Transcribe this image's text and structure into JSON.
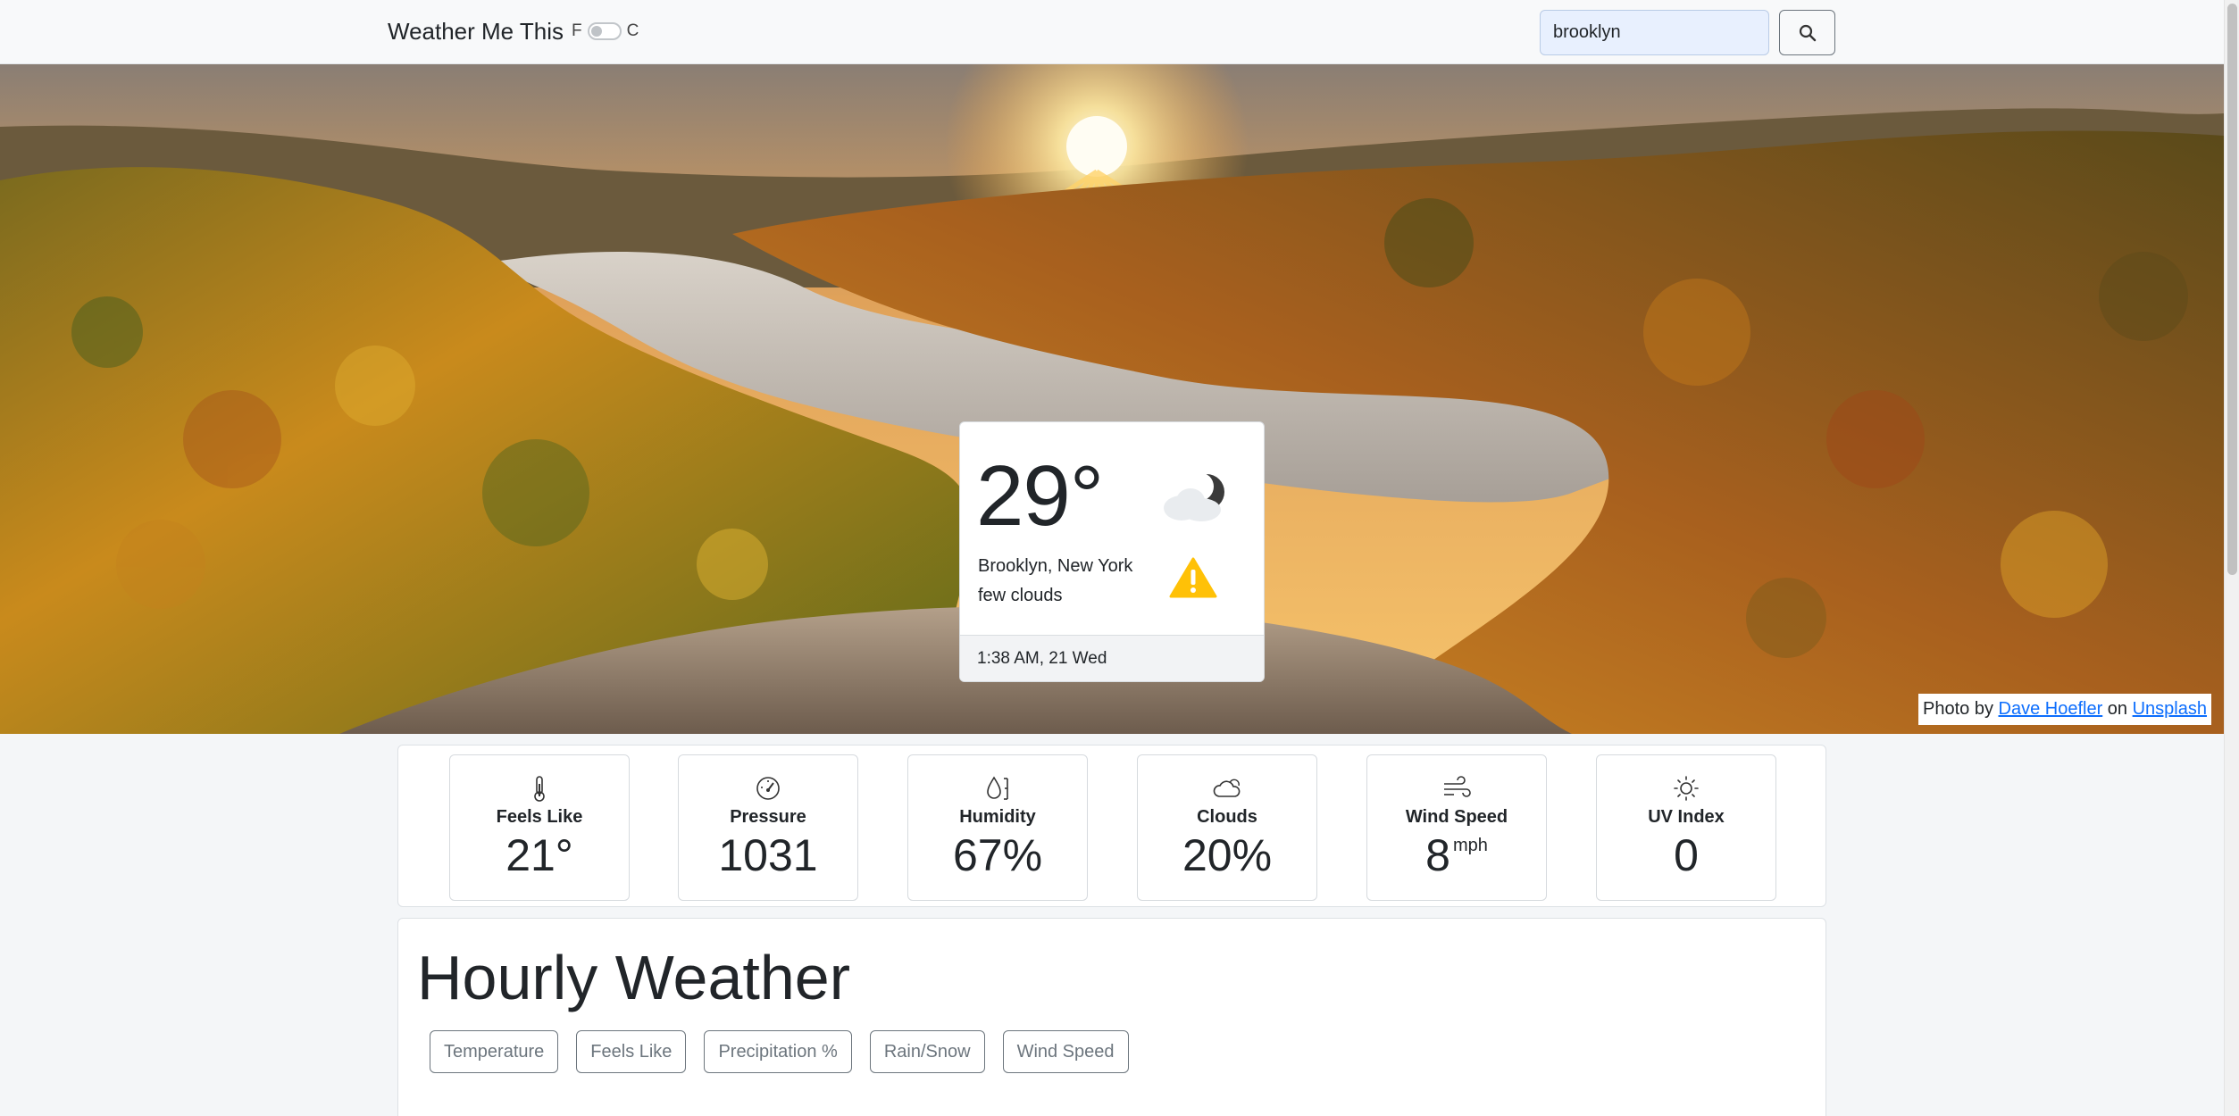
{
  "navbar": {
    "brand": "Weather Me This",
    "unit_f": "F",
    "unit_c": "C",
    "search_value": "brooklyn",
    "search_icon": "search-icon"
  },
  "hero": {
    "credit_prefix": "Photo by",
    "photographer": "Dave Hoefler",
    "credit_middle": "on",
    "source": "Unsplash"
  },
  "current": {
    "temperature": "29°",
    "location": "Brooklyn, New York",
    "description": "few clouds",
    "time": "1:38 AM, 21 Wed",
    "weather_icon": "cloud-moon-icon",
    "alert_icon": "warning-icon"
  },
  "stats": [
    {
      "label": "Feels Like",
      "value": "21°",
      "unit": "",
      "icon": "thermometer-icon"
    },
    {
      "label": "Pressure",
      "value": "1031",
      "unit": "",
      "icon": "speedometer-icon"
    },
    {
      "label": "Humidity",
      "value": "67%",
      "unit": "",
      "icon": "droplet-icon"
    },
    {
      "label": "Clouds",
      "value": "20%",
      "unit": "",
      "icon": "cloud-sun-icon"
    },
    {
      "label": "Wind Speed",
      "value": "8",
      "unit": "mph",
      "icon": "wind-icon"
    },
    {
      "label": "UV Index",
      "value": "0",
      "unit": "",
      "icon": "sun-icon"
    }
  ],
  "hourly": {
    "title": "Hourly Weather",
    "tabs": [
      "Temperature",
      "Feels Like",
      "Precipitation %",
      "Rain/Snow",
      "Wind Speed"
    ]
  },
  "colors": {
    "accent": "#0d6efd",
    "warning": "#ffc107",
    "text": "#212529",
    "muted": "#6c757d"
  }
}
